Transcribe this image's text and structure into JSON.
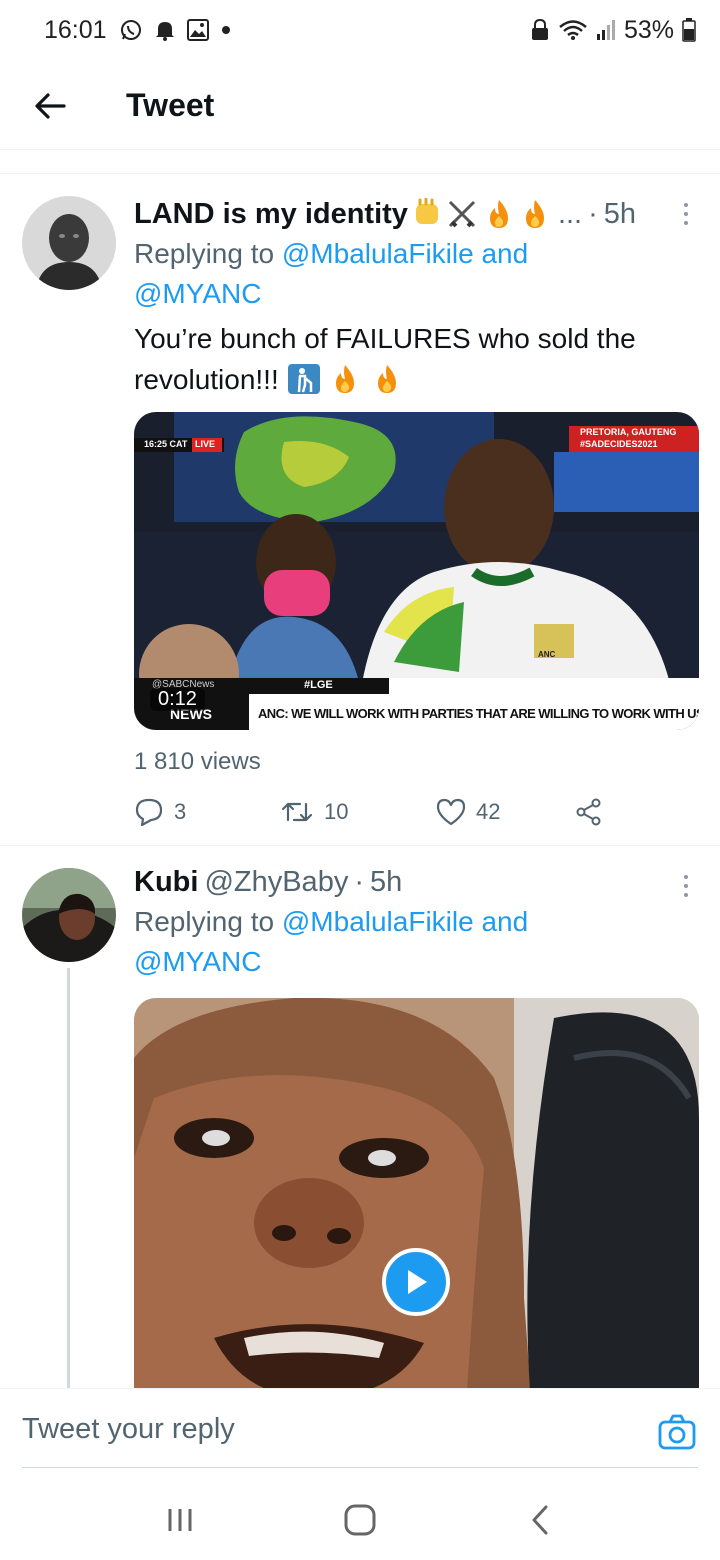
{
  "status_bar": {
    "time": "16:01",
    "battery": "53%",
    "icons": [
      "whatsapp-icon",
      "notification-bell-icon",
      "gallery-icon",
      "dot-icon",
      "lock-icon",
      "wifi-icon",
      "signal-icon",
      "battery-icon"
    ]
  },
  "header": {
    "title": "Tweet",
    "back_icon": "arrow-left-icon"
  },
  "tweets": [
    {
      "display_name": "LAND is my identity",
      "name_suffix": "...",
      "handle": "",
      "time": "5h",
      "replying_prefix": "Replying to ",
      "replying_mention1": "@MbalulaFikile",
      "replying_and": " and",
      "replying_mention2": "@MYANC",
      "text": "You’re bunch of FAILURES who sold the revolution!!!",
      "media": {
        "type": "video",
        "duration": "0:12",
        "caption_live_time": "16:25 CAT",
        "caption_live": "LIVE",
        "caption_location": "PRETORIA, GAUTENG",
        "caption_hashtag": "#SADECIDES2021",
        "caption_channel": "@SABCNews",
        "caption_news": "NEWS",
        "caption_tag": "#LGE",
        "caption_ticker": "ANC: WE WILL WORK WITH PARTIES THAT ARE WILLING TO WORK WITH US",
        "caption_logo": "ANC"
      },
      "views": "1 810 views",
      "reply_count": "3",
      "retweet_count": "10",
      "like_count": "42"
    },
    {
      "display_name": "Kubi",
      "handle": "@ZhyBaby",
      "time": "5h",
      "replying_prefix": "Replying to ",
      "replying_mention1": "@MbalulaFikile",
      "replying_and": " and",
      "replying_mention2": "@MYANC",
      "media": {
        "type": "video",
        "play_icon": "play-icon"
      }
    }
  ],
  "reply_bar": {
    "placeholder": "Tweet your reply",
    "camera_icon": "camera-icon"
  },
  "colors": {
    "accent": "#1d9bf0",
    "text_primary": "#0f1419",
    "text_secondary": "#536471"
  }
}
